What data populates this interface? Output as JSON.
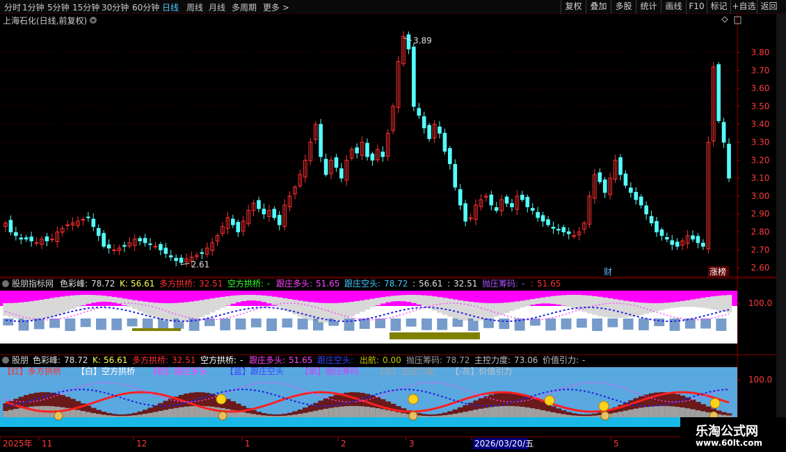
{
  "toolbar": {
    "periods": [
      "分时",
      "1分钟",
      "5分钟",
      "15分钟",
      "30分钟",
      "60分钟",
      "日线",
      "周线",
      "月线",
      "多周期",
      "更多 >"
    ],
    "active_period": "日线",
    "right_buttons": [
      "复权",
      "叠加",
      "多股",
      "统计",
      "画线",
      "F10",
      "标记",
      "+自选",
      "返回"
    ]
  },
  "main": {
    "title": "上海石化(日线,前复权)",
    "y_ticks": [
      "3.80",
      "3.70",
      "3.60",
      "3.50",
      "3.40",
      "3.30",
      "3.20",
      "3.10",
      "3.00",
      "2.90",
      "2.80",
      "2.70",
      "2.60"
    ],
    "y_tick_values": [
      3.8,
      3.7,
      3.6,
      3.5,
      3.4,
      3.3,
      3.2,
      3.1,
      3.0,
      2.9,
      2.8,
      2.7,
      2.6
    ],
    "high_label": "3.89",
    "low_label": "2.61",
    "tag_cai": "财",
    "tag_zhangbang": "涨榜",
    "up_color": "#ff3030",
    "down_color": "#54ffff",
    "price_series": [
      2.85,
      2.8,
      2.78,
      2.76,
      2.76,
      2.75,
      2.74,
      2.76,
      2.75,
      2.76,
      2.8,
      2.82,
      2.84,
      2.85,
      2.86,
      2.87,
      2.88,
      2.83,
      2.78,
      2.72,
      2.71,
      2.7,
      2.71,
      2.72,
      2.74,
      2.76,
      2.75,
      2.74,
      2.73,
      2.72,
      2.7,
      2.68,
      2.66,
      2.64,
      2.63,
      2.65,
      2.66,
      2.67,
      2.68,
      2.71,
      2.74,
      2.78,
      2.83,
      2.88,
      2.84,
      2.8,
      2.86,
      2.92,
      2.96,
      2.93,
      2.9,
      2.92,
      2.88,
      2.84,
      2.95,
      3.0,
      3.05,
      3.12,
      3.2,
      3.3,
      3.4,
      3.22,
      3.12,
      3.2,
      3.16,
      3.1,
      3.2,
      3.26,
      3.24,
      3.3,
      3.22,
      3.2,
      3.26,
      3.22,
      3.35,
      3.5,
      3.75,
      3.89,
      3.82,
      3.5,
      3.45,
      3.38,
      3.32,
      3.4,
      3.35,
      3.25,
      3.18,
      3.05,
      2.95,
      2.86,
      2.88,
      2.95,
      2.98,
      3.0,
      2.95,
      2.92,
      2.98,
      2.96,
      2.94,
      3.0,
      2.98,
      2.94,
      2.92,
      2.88,
      2.86,
      2.84,
      2.82,
      2.81,
      2.8,
      2.79,
      2.78,
      2.8,
      2.85,
      3.0,
      3.12,
      3.08,
      3.02,
      3.1,
      3.2,
      3.12,
      3.06,
      3.02,
      2.98,
      2.95,
      2.9,
      2.85,
      2.8,
      2.78,
      2.76,
      2.73,
      2.72,
      2.75,
      2.78,
      2.76,
      2.74,
      2.72,
      3.3,
      3.72,
      3.42,
      3.3,
      3.1
    ]
  },
  "ind1": {
    "name": "股朋指标网",
    "items": [
      {
        "label": "色彩峰:",
        "value": "78.72"
      },
      {
        "label": "K:",
        "value": "56.61"
      },
      {
        "label": "多方拱桥:",
        "value": "32.51"
      },
      {
        "label": "空方拱桥:",
        "value": "-"
      },
      {
        "label": "跟庄多头:",
        "value": "51.65"
      },
      {
        "label": "跟庄空头:",
        "value": "78.72"
      },
      {
        "label": ":",
        "value": "56.61"
      },
      {
        "label": ":",
        "value": "32.51"
      },
      {
        "label": "抛压筹码:",
        "value": "-"
      },
      {
        "label": ":",
        "value": "51.65"
      }
    ],
    "ytick": "100.0"
  },
  "ind2": {
    "name": "股朋",
    "items": [
      {
        "label": "色彩峰:",
        "value": "78.72"
      },
      {
        "label": "K:",
        "value": "56.61"
      },
      {
        "label": "多方拱桥:",
        "value": "32.51"
      },
      {
        "label": "空方拱桥:",
        "value": "-"
      },
      {
        "label": "跟庄多头:",
        "value": "51.65"
      },
      {
        "label": "跟庄空头:",
        "value": ""
      },
      {
        "label": "出航:",
        "value": "0.00"
      },
      {
        "label": "抛压筹码:",
        "value": "78.72"
      },
      {
        "label": "主控力度:",
        "value": "73.06"
      },
      {
        "label": "价值引力:",
        "value": "-"
      }
    ],
    "legend": [
      "【红】多方拱桥",
      "【白】空方拱桥",
      "【粉】跟庄多头",
      "【蓝】跟庄空头",
      "【紫】抛压筹码",
      "【灰】主控力度",
      "【-灰】价值引力"
    ],
    "ytick": "100.0"
  },
  "date_axis": {
    "labels": [
      "2025年",
      "11",
      "12",
      "1",
      "2",
      "3",
      "2026/03/20/五",
      "5"
    ]
  },
  "watermark": {
    "title": "乐淘公式网",
    "url": "www.60lt.com"
  }
}
